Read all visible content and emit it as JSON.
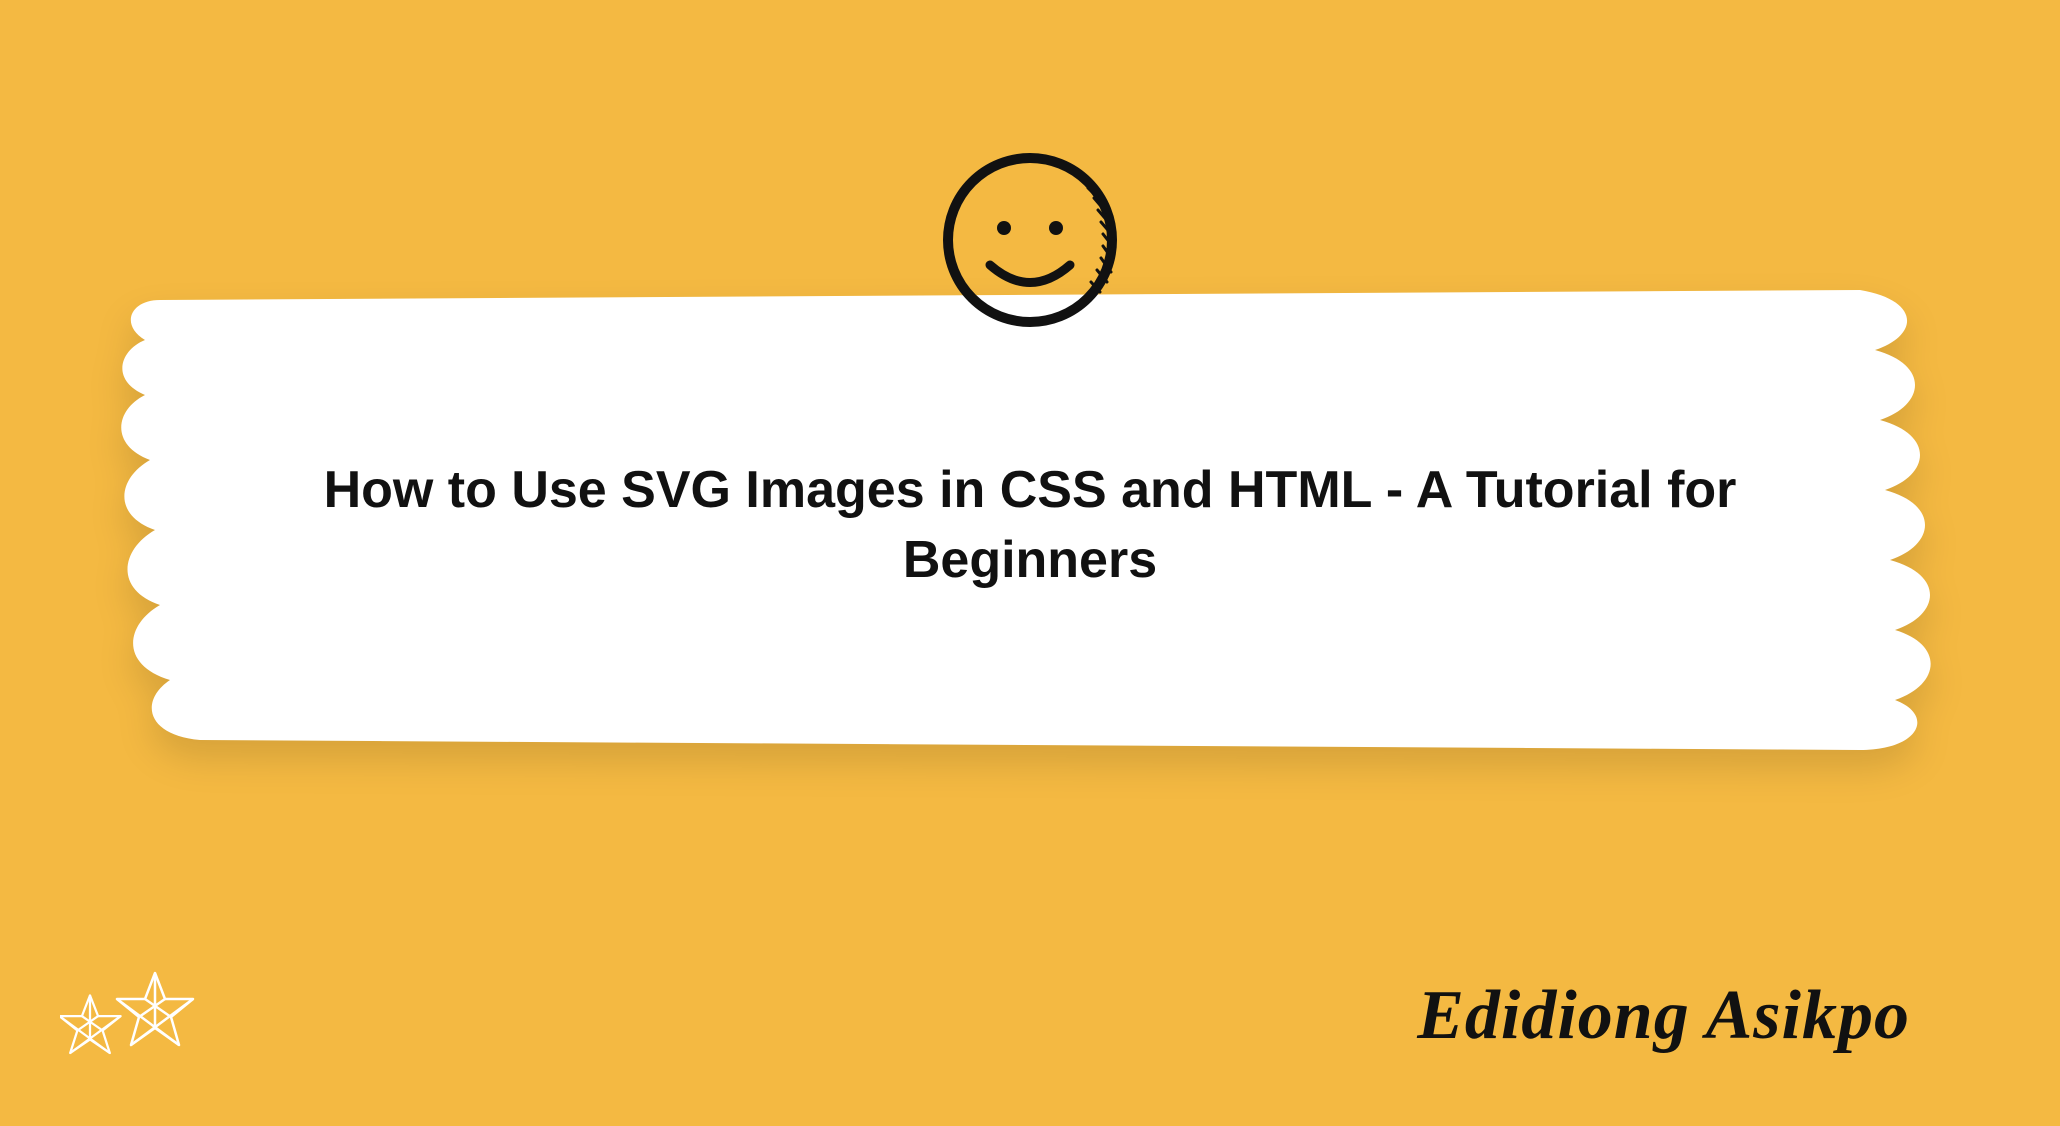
{
  "header_title": "How to Use SVG Images in CSS and HTML - A Tutorial for Beginners",
  "author_name": "Edidiong Asikpo",
  "colors": {
    "background": "#f4b942",
    "text": "#111111",
    "brush": "#ffffff"
  }
}
